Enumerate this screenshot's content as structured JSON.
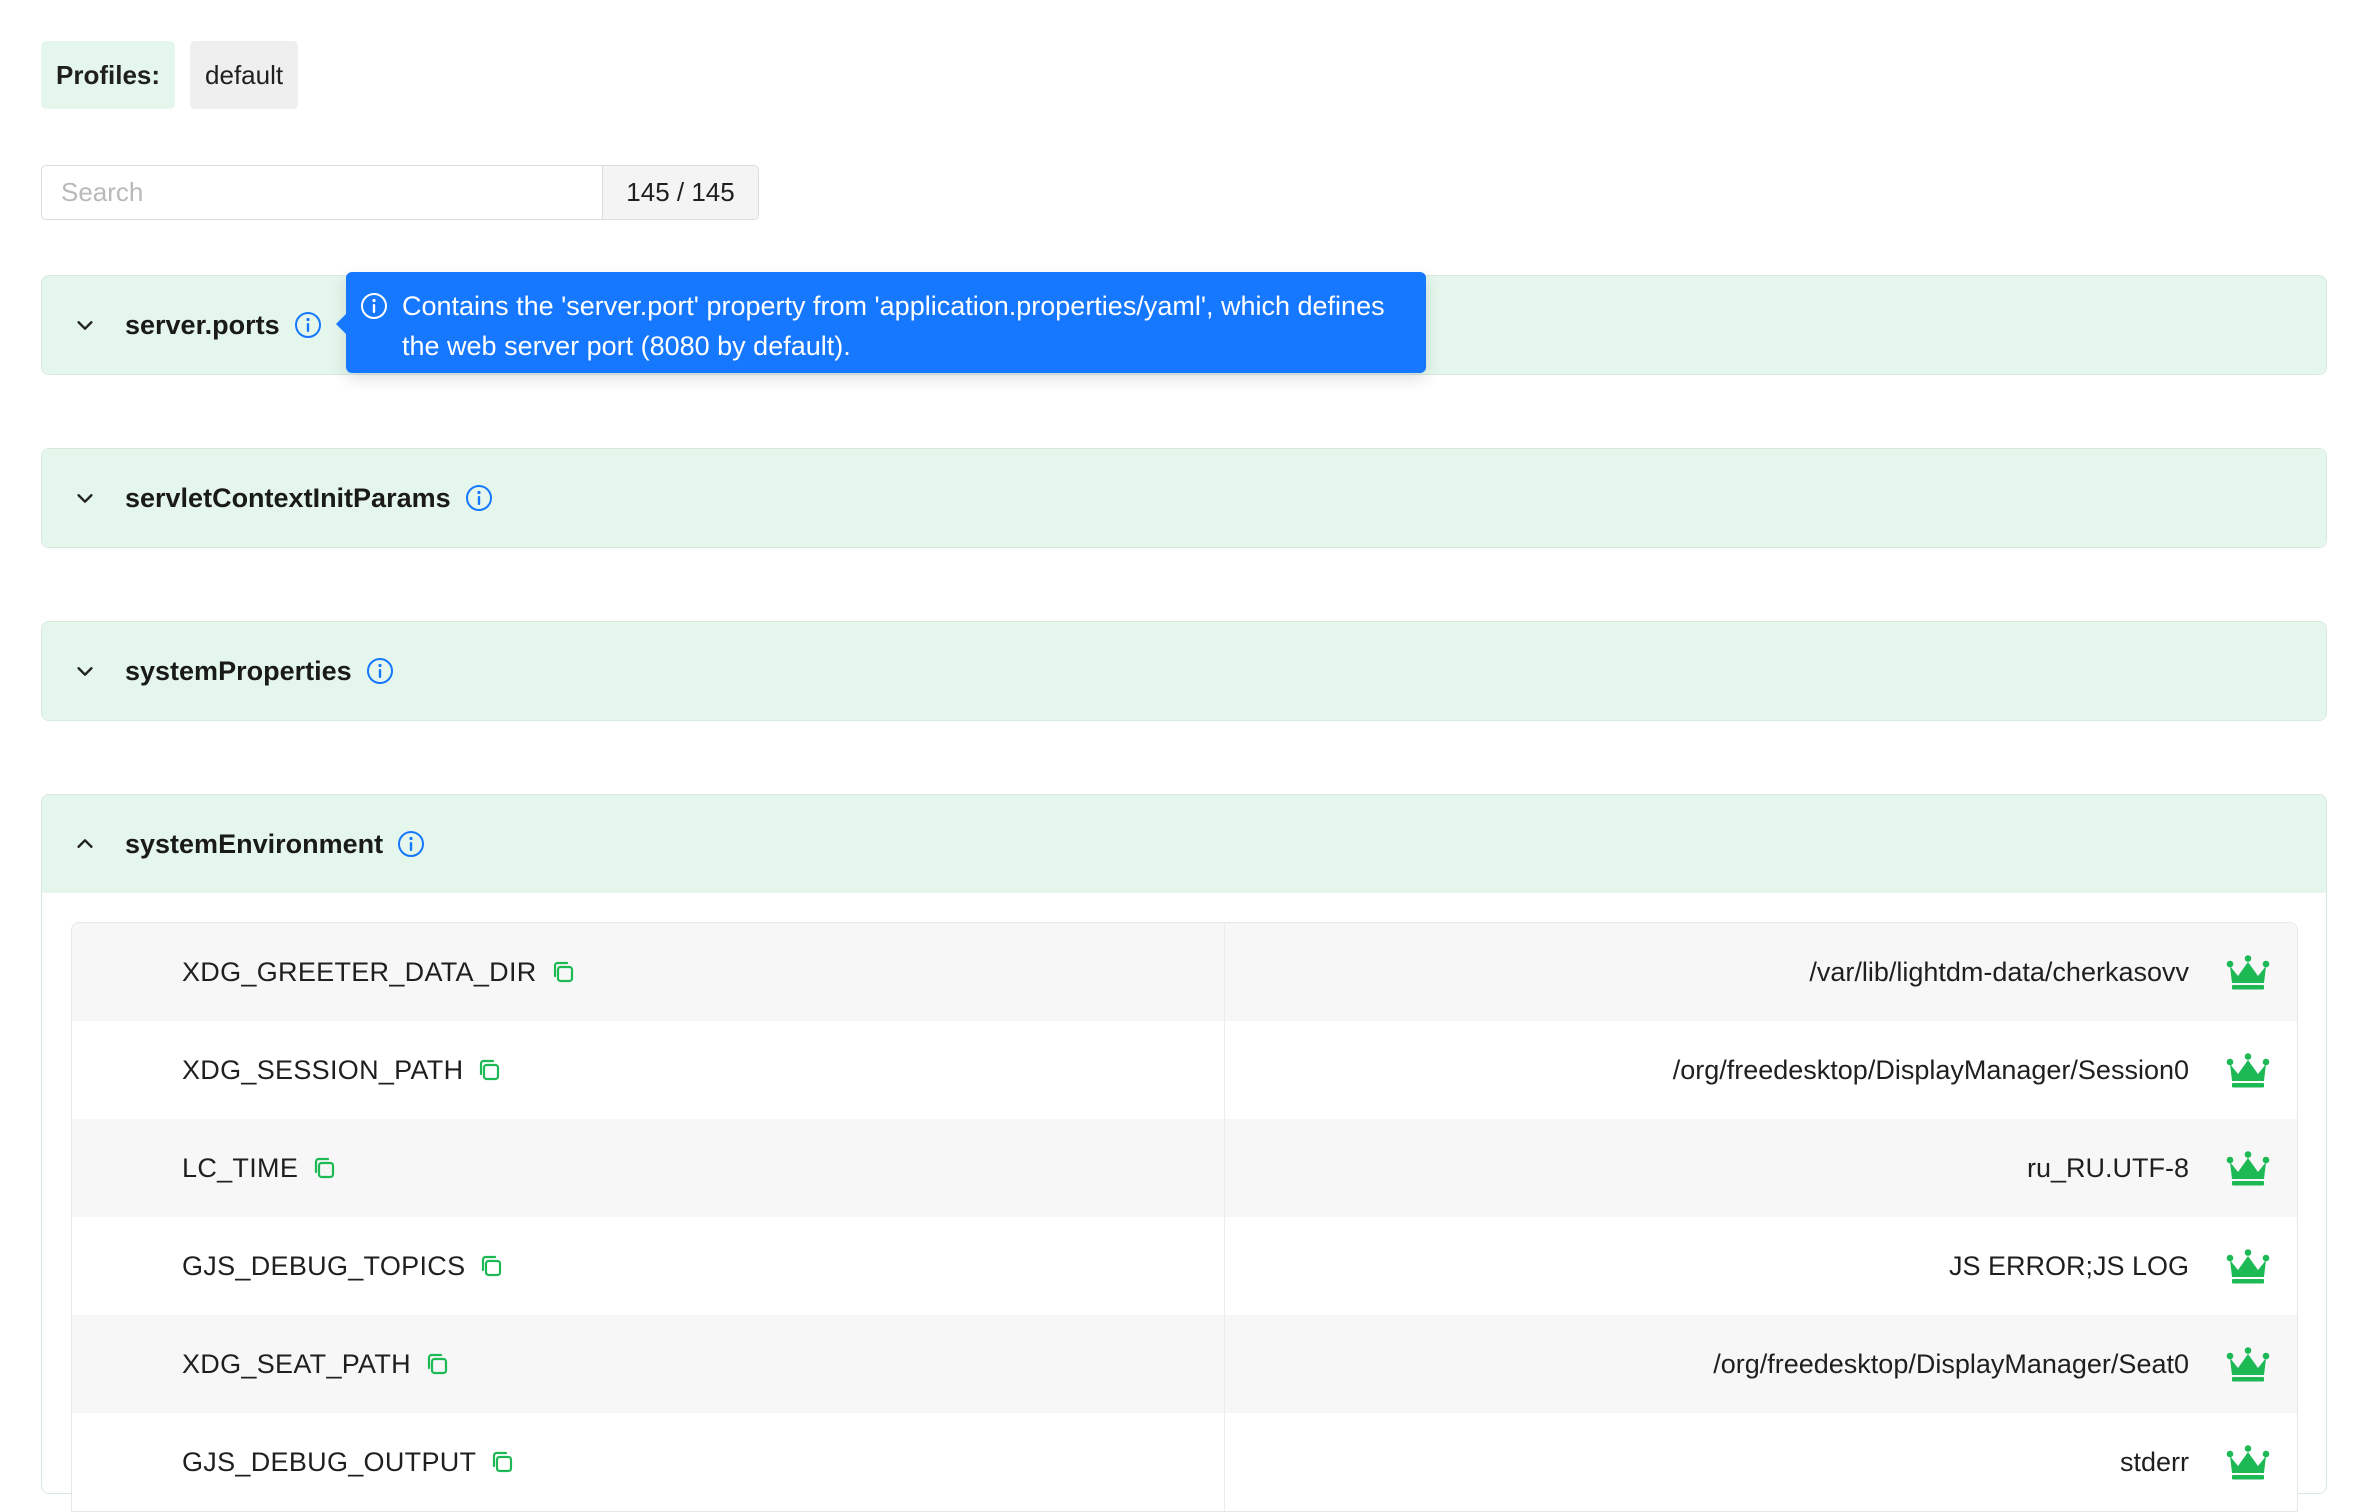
{
  "profiles": {
    "label": "Profiles:",
    "value": "default"
  },
  "search": {
    "placeholder": "Search",
    "count": "145 / 145"
  },
  "tooltip": {
    "text": "Contains the 'server.port' property from 'application.properties/yaml', which defines the web server port (8080 by default)."
  },
  "sections": [
    {
      "title": "server.ports",
      "expanded": false
    },
    {
      "title": "servletContextInitParams",
      "expanded": false
    },
    {
      "title": "systemProperties",
      "expanded": false
    },
    {
      "title": "systemEnvironment",
      "expanded": true
    }
  ],
  "env_rows": [
    {
      "key": "XDG_GREETER_DATA_DIR",
      "value": "/var/lib/lightdm-data/cherkasovv"
    },
    {
      "key": "XDG_SESSION_PATH",
      "value": "/org/freedesktop/DisplayManager/Session0"
    },
    {
      "key": "LC_TIME",
      "value": "ru_RU.UTF-8"
    },
    {
      "key": "GJS_DEBUG_TOPICS",
      "value": "JS ERROR;JS LOG"
    },
    {
      "key": "XDG_SEAT_PATH",
      "value": "/org/freedesktop/DisplayManager/Seat0"
    },
    {
      "key": "GJS_DEBUG_OUTPUT",
      "value": "stderr"
    }
  ],
  "icons": {
    "info": "info-circle-icon",
    "copy": "copy-icon",
    "crown": "crown-icon",
    "chevron_down": "chevron-down-icon",
    "chevron_up": "chevron-up-icon"
  },
  "colors": {
    "accent_green": "#1db954",
    "header_bg": "#e5f7ec",
    "info_blue": "#1677ff"
  }
}
